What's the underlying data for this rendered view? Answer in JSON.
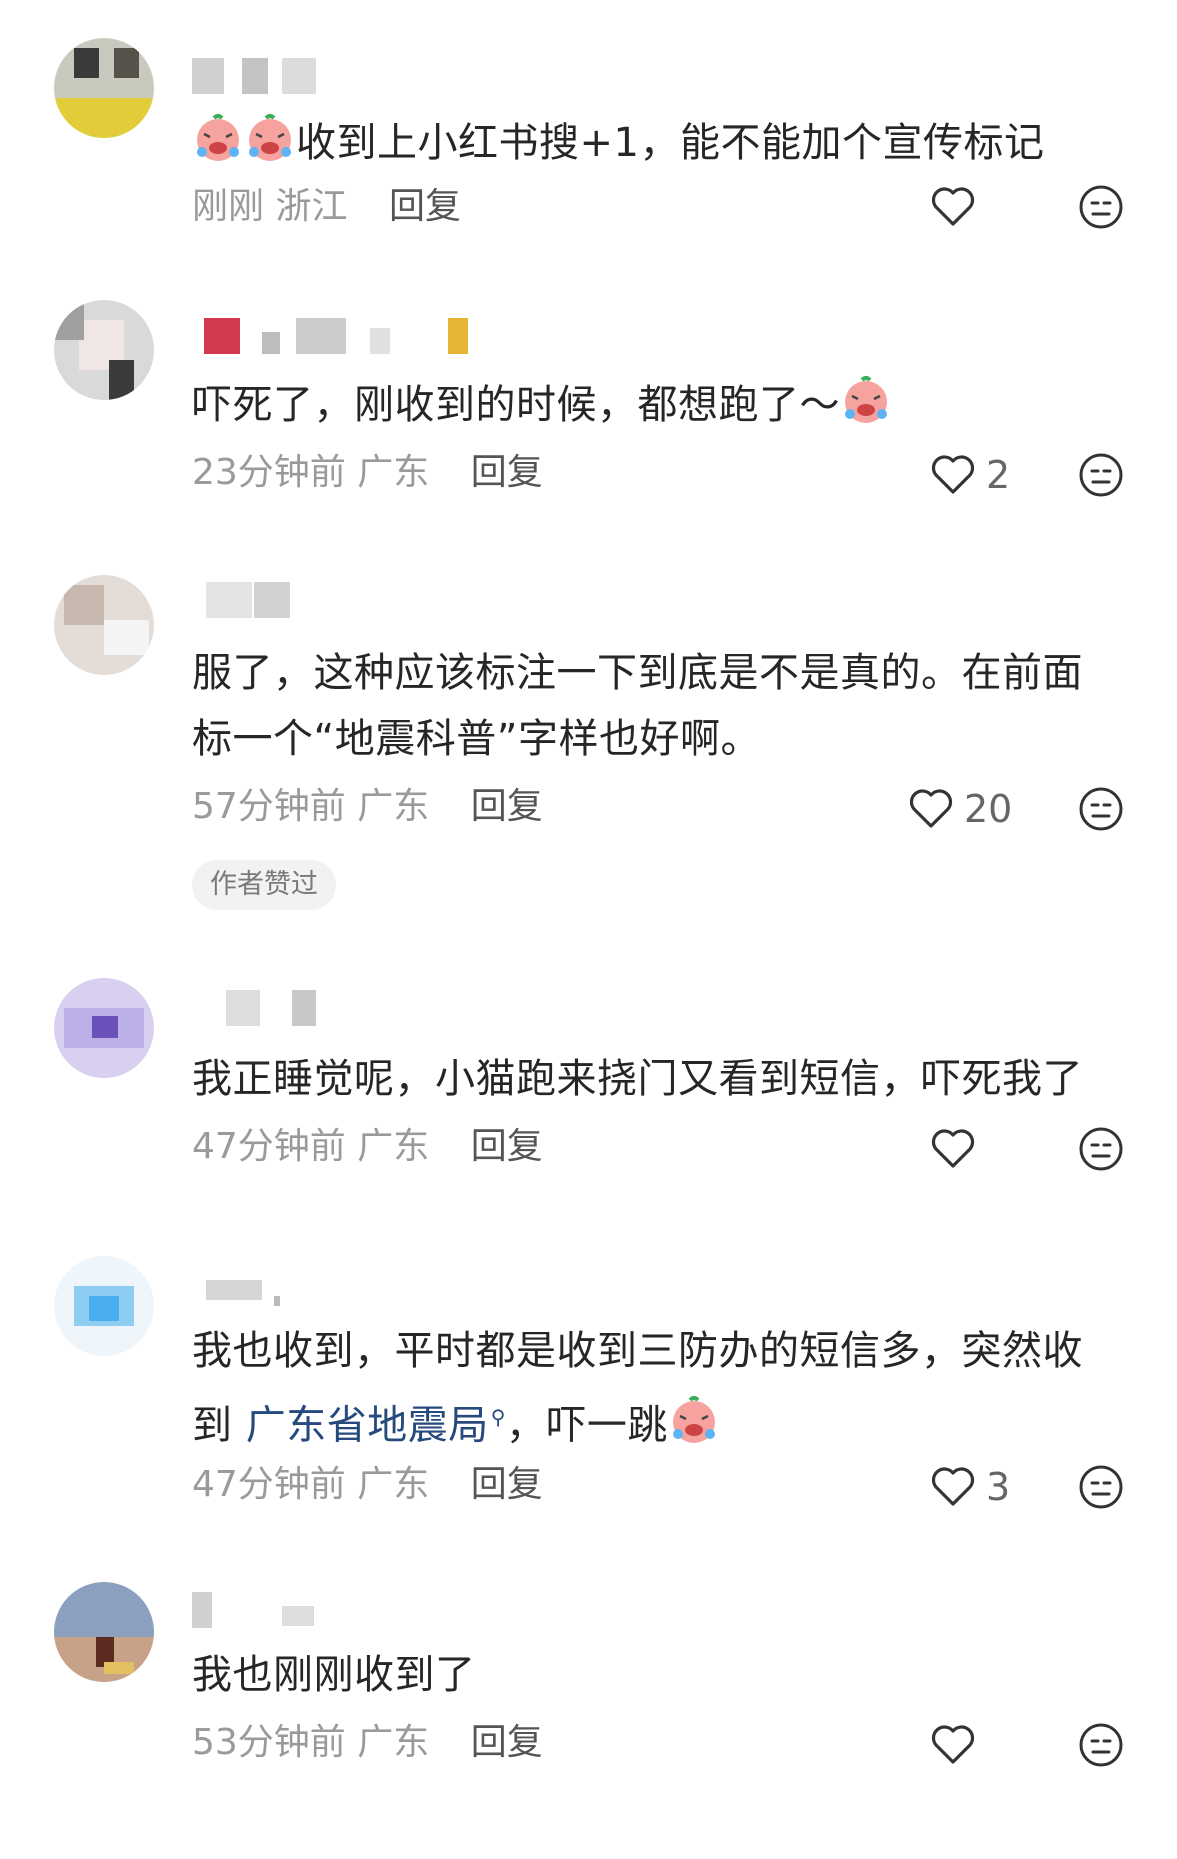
{
  "comments": [
    {
      "text_parts": [
        "收到上小红书搜+1，能不能加个宣传标记"
      ],
      "leading_emoji_count": 2,
      "time": "刚刚",
      "location": "浙江",
      "reply_label": "回复",
      "likes": "",
      "liked_icon": "heart-outline-icon",
      "avatar_colors": [
        "#b7b7a8",
        "#3a3a3a",
        "#e8d34a",
        "#d9d9d9"
      ]
    },
    {
      "text_parts": [
        "吓死了，刚收到的时候，都想跑了～"
      ],
      "trailing_emoji": true,
      "time": "23分钟前",
      "location": "广东",
      "reply_label": "回复",
      "likes": "2",
      "avatar_colors": [
        "#cfcfcf",
        "#8a8a8a",
        "#e0c8c8",
        "#f0f0f0"
      ]
    },
    {
      "text_parts": [
        "服了，这种应该标注一下到底是不是真的。在前面",
        "标一个“地震科普”字样也好啊。"
      ],
      "time": "57分钟前",
      "location": "广东",
      "reply_label": "回复",
      "likes": "20",
      "badge": "作者赞过",
      "avatar_colors": [
        "#d8d0ca",
        "#eeeeee",
        "#bfb6b0",
        "#f7f7f7"
      ]
    },
    {
      "text_parts": [
        "我正睡觉呢，小猫跑来挠门又看到短信，吓死我了"
      ],
      "time": "47分钟前",
      "location": "广东",
      "reply_label": "回复",
      "likes": "",
      "avatar_colors": [
        "#d7ccf0",
        "#a998d8",
        "#6a50b8",
        "#eee9f8"
      ]
    },
    {
      "text_parts": [
        "我也收到，平时都是收到三防办的短信多，突然收",
        "到 "
      ],
      "link_text": "广东省地震局",
      "after_link": "，吓一跳",
      "trailing_emoji": true,
      "time": "47分钟前",
      "location": "广东",
      "reply_label": "回复",
      "likes": "3",
      "avatar_colors": [
        "#e8f3fb",
        "#9fd3f3",
        "#5fb8ee",
        "#f4fafe"
      ]
    },
    {
      "text_parts": [
        "我也刚刚收到了"
      ],
      "time": "53分钟前",
      "location": "广东",
      "reply_label": "回复",
      "likes": "",
      "avatar_colors": [
        "#9aa8bf",
        "#c4a48a",
        "#5b3a2a",
        "#d8c07a"
      ]
    }
  ],
  "icons": {
    "like": "heart-outline-icon",
    "dislike": "neutral-face-icon",
    "emoji": "crying-laughing-face-icon"
  }
}
